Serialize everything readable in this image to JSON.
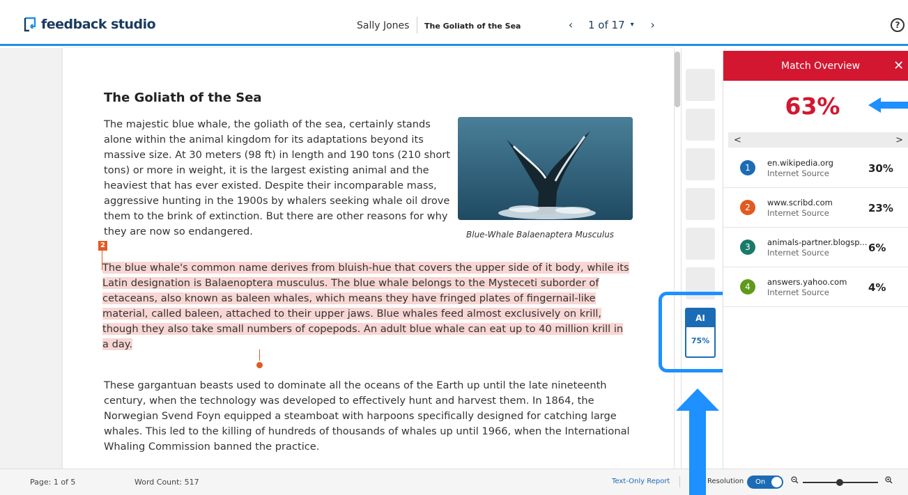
{
  "header": {
    "app_name": "feedback studio",
    "student_name": "Sally Jones",
    "paper_title": "The Goliath of the Sea",
    "page_indicator": "1 of 17",
    "prev": "‹",
    "next": "›",
    "dropdown": "▾",
    "help": "?"
  },
  "document": {
    "title": "The Goliath of the Sea",
    "paragraph1": "The majestic blue whale, the goliath of the sea, certainly stands alone within the animal kingdom for its adaptations beyond its massive size. At 30 meters (98 ft) in length and 190 tons (210 short tons) or more in weight, it is the largest existing animal and the heaviest that has ever existed. Despite their incomparable mass, aggressive hunting in the 1900s by whalers seeking whale oil drove them to the brink of extinction. But there are other reasons for why they are now so endangered.",
    "highlighted_paragraph": "The blue whale's common name derives from bluish-hue that covers the upper side of it body, while its Latin designation is Balaenoptera musculus. The blue whale belongs to the Mysteceti suborder of cetaceans, also known as baleen whales, which means they have fringed plates of fingernail-like material, called baleen, attached to their upper jaws. Blue whales feed almost exclusively on krill, though they also take small numbers of copepods. An adult blue whale can eat up to 40 million krill in a day.",
    "paragraph3": "These gargantuan beasts used to dominate all the oceans of the Earth up until the late nineteenth century, when the technology was developed to effectively hunt and harvest them. In 1864, the Norwegian Svend Foyn equipped a steamboat with harpoons specifically designed for catching large whales. This led to the killing of hundreds of thousands of whales up until 1966, when the International Whaling Commission banned the practice.",
    "image_caption": "Blue-Whale Balaenaptera Musculus",
    "match_marker": "2"
  },
  "ai_indicator": {
    "label": "AI",
    "percent": "75%"
  },
  "panel": {
    "title": "Match Overview",
    "close": "✕",
    "overall_percent": "63%",
    "nav_prev": "<",
    "nav_next": ">",
    "sources": [
      {
        "num": "1",
        "name": "en.wikipedia.org",
        "type": "Internet Source",
        "percent": "30%",
        "color": "#1c6bb5"
      },
      {
        "num": "2",
        "name": "www.scribd.com",
        "type": "Internet Source",
        "percent": "23%",
        "color": "#e05a22"
      },
      {
        "num": "3",
        "name": "animals-partner.blogsp...",
        "type": "Internet Source",
        "percent": "6%",
        "color": "#1a7a6a"
      },
      {
        "num": "4",
        "name": "answers.yahoo.com",
        "type": "Internet Source",
        "percent": "4%",
        "color": "#5f9a1a"
      }
    ]
  },
  "footer": {
    "page": "Page: 1 of 5",
    "word_count": "Word Count: 517",
    "text_only_report": "Text-Only Report",
    "resolution_label": "Resolution",
    "toggle_state": "On",
    "zoom_out": "🔍︎",
    "zoom_in": "🔍︎"
  },
  "colors": {
    "brand_blue": "#1f8fe5",
    "match_red": "#d31730",
    "highlight": "#f8d6d3",
    "callout_blue": "#1e90ff"
  }
}
